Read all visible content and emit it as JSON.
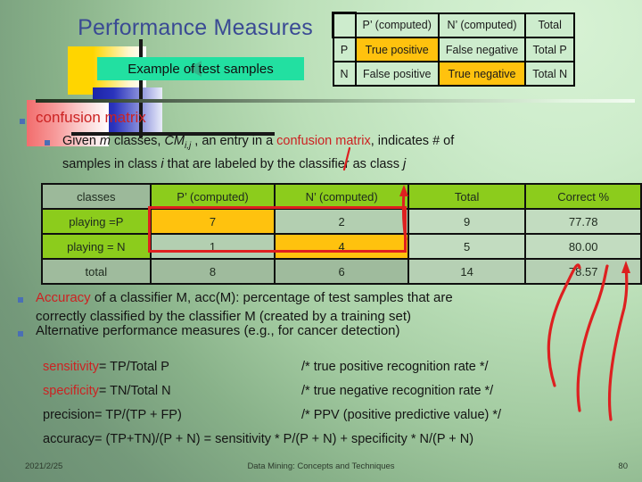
{
  "slide": {
    "title": "Performance Measures",
    "subtitle": "Example of test samples",
    "accent_red": "#cc2222",
    "accent_blue": "#3a4a94",
    "highlight_orange": "#ffc20e",
    "header_green": "#8ccc1c",
    "subtitle_box_green": "#22e0a1"
  },
  "truth_table": {
    "header": [
      "",
      "P’ (computed)",
      "N’ (computed)",
      "Total"
    ],
    "rows": [
      {
        "label": "P",
        "cells": [
          "True positive",
          "False negative",
          "Total P"
        ],
        "highlight": 0
      },
      {
        "label": "N",
        "cells": [
          "False positive",
          "True negative",
          "Total N"
        ],
        "highlight": 1
      }
    ]
  },
  "bullets": {
    "level1_label": "confusion matrix",
    "level2_line1_a": "Given ",
    "level2_line1_m": "m",
    "level2_line1_b": " classes, ",
    "level2_line1_cm": "CM",
    "level2_line1_sub": "i,j",
    "level2_line1_c": " , an entry in a ",
    "level2_line1_red": "confusion matrix",
    "level2_line1_d": ", indicates # of",
    "level2_line2_a": "samples in class ",
    "level2_line2_i": "i",
    "level2_line2_b": " that are labeled by the classifier as class ",
    "level2_line2_j": "j"
  },
  "confusion_matrix": {
    "columns": [
      "classes",
      "P’ (computed)",
      "N’ (computed)",
      "Total",
      "Correct %"
    ],
    "rows": [
      {
        "label": "playing =P",
        "values": [
          "7",
          "2",
          "9",
          "77.78"
        ],
        "highlight": 0
      },
      {
        "label": "playing = N",
        "values": [
          "1",
          "4",
          "5",
          "80.00"
        ],
        "highlight": 1
      },
      {
        "label": "total",
        "values": [
          "8",
          "6",
          "14",
          "78.57"
        ],
        "highlight": -1
      }
    ]
  },
  "accuracy_para": {
    "name": "Accuracy",
    "rest_line1": " of a classifier M, acc(M): percentage of test samples that are",
    "line2": "correctly classified by the classifier M (created by a training set)"
  },
  "alternative_para": {
    "text": "Alternative performance measures (e.g., for cancer detection)"
  },
  "formulas": [
    {
      "name": "sensitivity",
      "name_colored": true,
      "expr": " = TP/Total P",
      "comment": "/* true positive recognition rate */"
    },
    {
      "name": "specificity",
      "name_colored": true,
      "expr": " = TN/Total N",
      "comment": "/* true negative recognition rate */"
    },
    {
      "name": "precision",
      "name_colored": false,
      "expr": " =  TP/(TP + FP)",
      "comment": "/* PPV (positive predictive value) */"
    },
    {
      "name": "accuracy",
      "name_colored": false,
      "expr": " = (TP+TN)/(P + N) = sensitivity * P/(P + N) + specificity * N/(P + N)",
      "comment": ""
    }
  ],
  "footer": {
    "date": "2021/2/25",
    "center": "Data Mining: Concepts and Techniques",
    "page": "80"
  }
}
